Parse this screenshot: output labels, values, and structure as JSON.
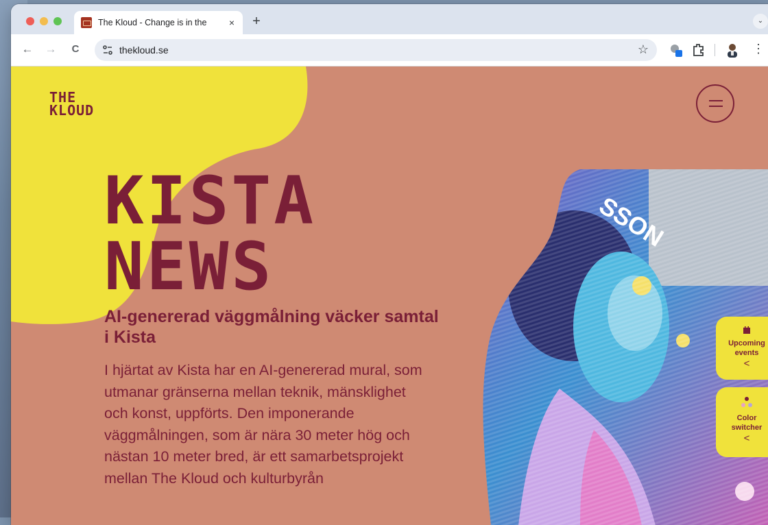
{
  "browser": {
    "tab_title": "The Kloud - Change is in the",
    "tab_close": "×",
    "new_tab": "+",
    "url": "thekloud.se",
    "back": "←",
    "forward": "→",
    "reload": "C",
    "bookmark_star": "☆",
    "tab_menu": "⌄",
    "more_menu": "⋮"
  },
  "site": {
    "logo_line1": "THE",
    "logo_line2": "KLOUD",
    "headline_line1": "KISTA",
    "headline_line2": "NEWS",
    "subhead": "AI-genererad väggmålning väcker samtal i Kista",
    "body": "I hjärtat av Kista har en AI-genererad mural, som utmanar gränserna mellan teknik, mänsklighet och konst, uppförts. Den imponerande väggmålningen, som är nära 30 meter hög och nästan 10 meter bred, är ett samarbetsprojekt mellan The Kloud och kulturbyrån",
    "image_sign": "SSON",
    "upcoming_events": "Upcoming events",
    "color_switcher": "Color switcher",
    "chevron": "<"
  },
  "colors": {
    "page_bg": "#cf8a73",
    "accent_yellow": "#f0e23b",
    "text_maroon": "#7a1f37"
  }
}
